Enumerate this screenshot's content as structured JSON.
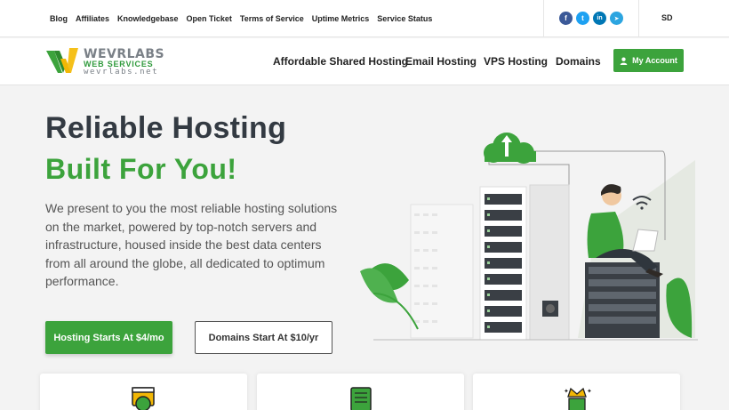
{
  "topbar": {
    "links": [
      "Blog",
      "Affiliates",
      "Knowledgebase",
      "Open Ticket",
      "Terms of Service",
      "Uptime Metrics",
      "Service Status"
    ],
    "socials": [
      {
        "icon": "facebook-icon",
        "glyph": "f",
        "color": "#3b5998"
      },
      {
        "icon": "twitter-icon",
        "glyph": "t",
        "color": "#1da1f2"
      },
      {
        "icon": "linkedin-icon",
        "glyph": "in",
        "color": "#0077b5"
      },
      {
        "icon": "telegram-icon",
        "glyph": "➤",
        "color": "#2ca5e0"
      }
    ],
    "language": "SD"
  },
  "logo": {
    "line1": "WEVRLABS",
    "line2": "WEB SERVICES",
    "line3": "wevrlabs.net"
  },
  "nav": {
    "items": [
      "Affordable Shared Hosting",
      "Email Hosting",
      "VPS Hosting",
      "Domains"
    ],
    "account_label": "My Account"
  },
  "hero": {
    "title_line1": "Reliable Hosting",
    "title_line2": "Built For You!",
    "lead": "We present to you the most reliable hosting solutions on the market, powered by top-notch servers and infrastructure, housed inside the best data centers from all around the globe, all dedicated to optimum performance.",
    "primary_button": "Hosting Starts At $4/mo",
    "secondary_button": "Domains Start At $10/yr"
  },
  "colors": {
    "brand_green": "#3ca33c",
    "dark_text": "#333a42"
  }
}
